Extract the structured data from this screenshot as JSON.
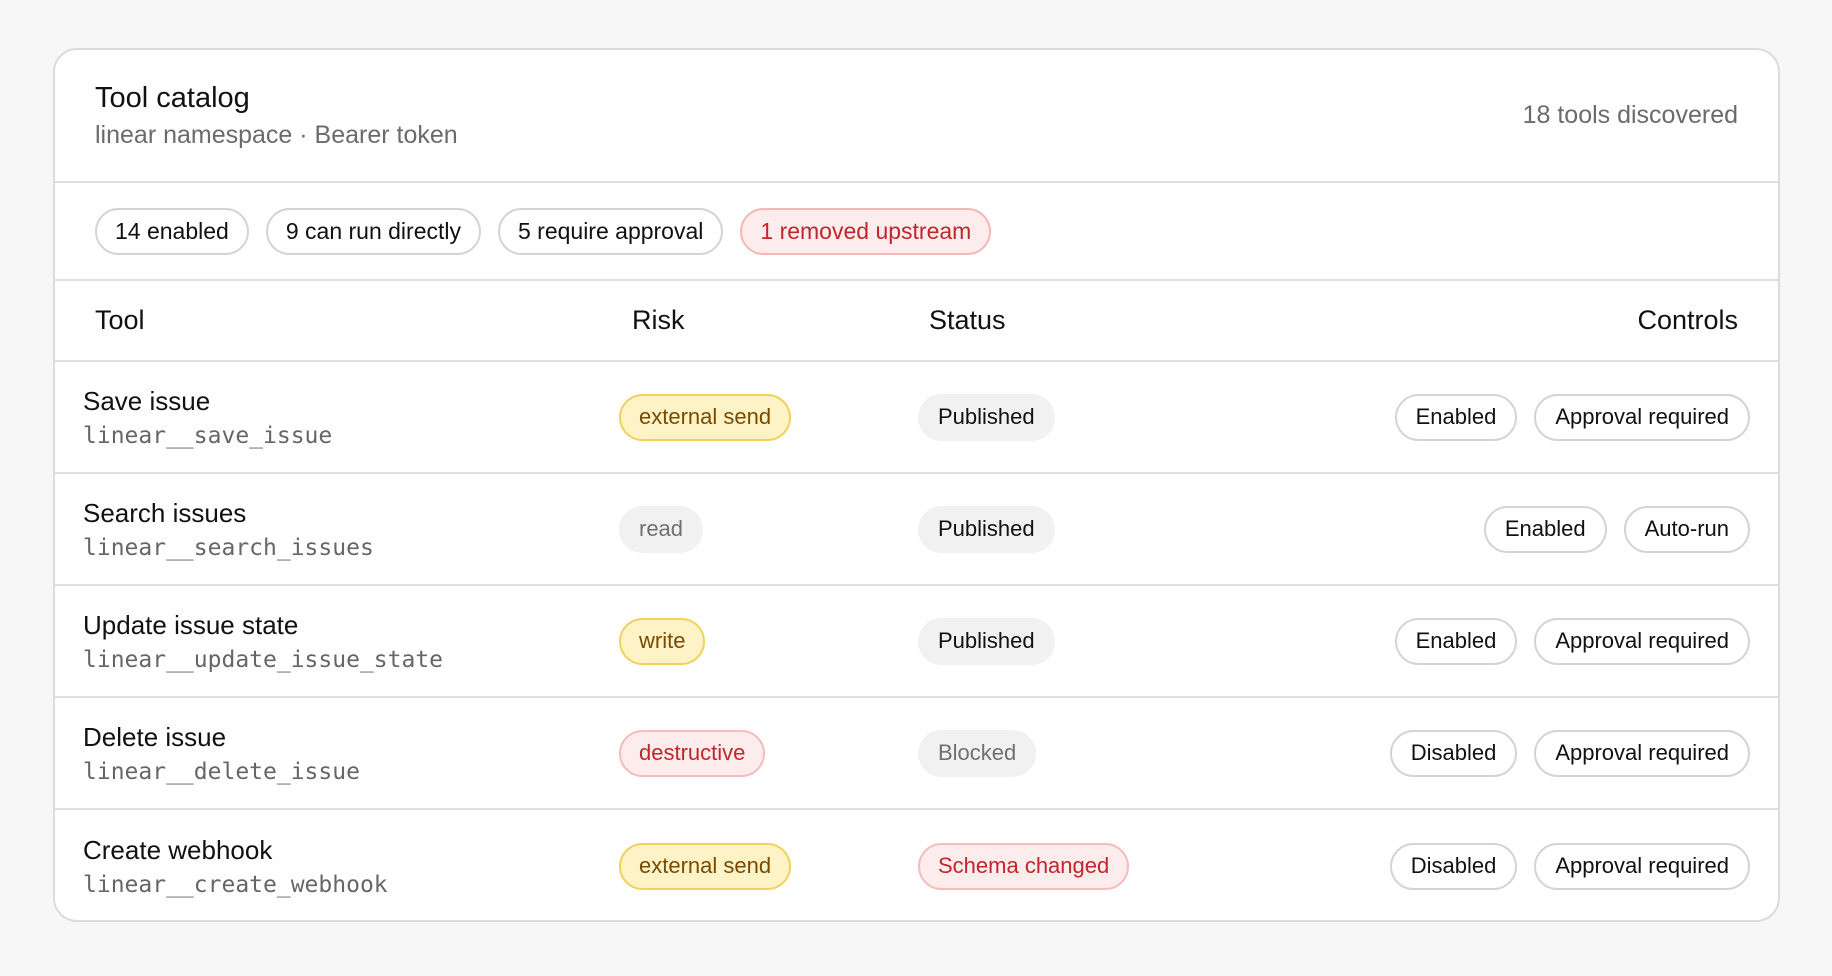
{
  "header": {
    "title": "Tool catalog",
    "subtitle": "linear namespace · Bearer token",
    "count": "18 tools discovered"
  },
  "summary": {
    "chips": [
      "14 enabled",
      "9 can run directly",
      "5 require approval",
      "1 removed upstream"
    ]
  },
  "table": {
    "columns": [
      "Tool",
      "Risk",
      "Status",
      "Controls"
    ],
    "rows": [
      {
        "name": "Save issue",
        "id": "linear__save_issue",
        "risk": "external send",
        "status": "Published",
        "enabled": "Enabled",
        "mode": "Approval required"
      },
      {
        "name": "Search issues",
        "id": "linear__search_issues",
        "risk": "read",
        "status": "Published",
        "enabled": "Enabled",
        "mode": "Auto-run"
      },
      {
        "name": "Update issue state",
        "id": "linear__update_issue_state",
        "risk": "write",
        "status": "Published",
        "enabled": "Enabled",
        "mode": "Approval required"
      },
      {
        "name": "Delete issue",
        "id": "linear__delete_issue",
        "risk": "destructive",
        "status": "Blocked",
        "enabled": "Disabled",
        "mode": "Approval required"
      },
      {
        "name": "Create webhook",
        "id": "linear__create_webhook",
        "risk": "external send",
        "status": "Schema changed",
        "enabled": "Disabled",
        "mode": "Approval required"
      }
    ]
  },
  "colors": {
    "warning_bg": "#fdf3c7",
    "warning_text": "#7a4a00",
    "danger_bg": "#fdecec",
    "danger_text": "#c0262d",
    "neutral_bg": "#f1f1f1"
  }
}
